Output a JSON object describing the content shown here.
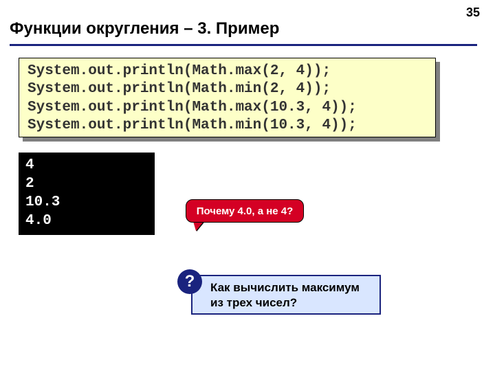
{
  "pageNumber": "35",
  "title": "Функции округления – 3. Пример",
  "code": "System.out.println(Math.max(2, 4));\nSystem.out.println(Math.min(2, 4));\nSystem.out.println(Math.max(10.3, 4));\nSystem.out.println(Math.min(10.3, 4));",
  "output": "4\n2\n10.3\n4.0",
  "callout": "Почему 4.0, а не 4?",
  "qmark": "?",
  "question": "  Как вычислить максимум из трех чисел?"
}
